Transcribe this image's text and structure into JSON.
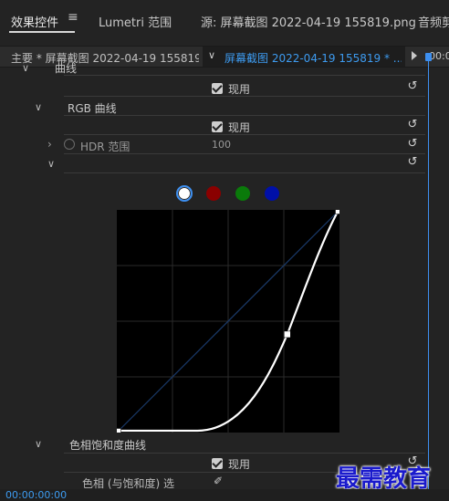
{
  "tabs": {
    "effects": "效果控件",
    "menu_icon": "≡",
    "lumetri": "Lumetri 范围",
    "source": "源: 屏幕截图 2022-04-19  155819.png",
    "audio": "音频剪"
  },
  "subheader": {
    "master": "主要 * 屏幕截图 2022-04-19 155819...",
    "clip": "屏幕截图 2022-04-19 155819 * ...",
    "timeline_time": "00:0"
  },
  "rows": {
    "curves_title": "曲线",
    "enabled_1": "现用",
    "rgb_curves": "RGB 曲线",
    "enabled_2": "现用",
    "hdr_range_label": "HDR 范围",
    "hdr_range_value": "100",
    "hue_sat_curves": "色相饱和度曲线",
    "enabled_3": "现用",
    "hue_vs_sat": "色相 (与饱和度) 选"
  },
  "channels": [
    {
      "name": "white",
      "color": "#ffffff",
      "selected": true
    },
    {
      "name": "red",
      "color": "#8a0000",
      "selected": false
    },
    {
      "name": "green",
      "color": "#0a7a0a",
      "selected": false
    },
    {
      "name": "blue",
      "color": "#0010a8",
      "selected": false
    }
  ],
  "curve": {
    "points": [
      [
        0,
        0
      ],
      [
        0.77,
        0.44
      ],
      [
        1,
        1
      ]
    ],
    "curve_color": "#ffffff",
    "diagonal_color": "#1a3a6a"
  },
  "watermark": "最需教育",
  "footer": {
    "timecode": "00:00:00:00"
  },
  "icons": [
    "hamburger-menu-icon",
    "chevron-down-icon",
    "chevron-right-icon",
    "reset-icon",
    "eyedropper-icon",
    "stopwatch-icon",
    "play-arrow-icon"
  ]
}
